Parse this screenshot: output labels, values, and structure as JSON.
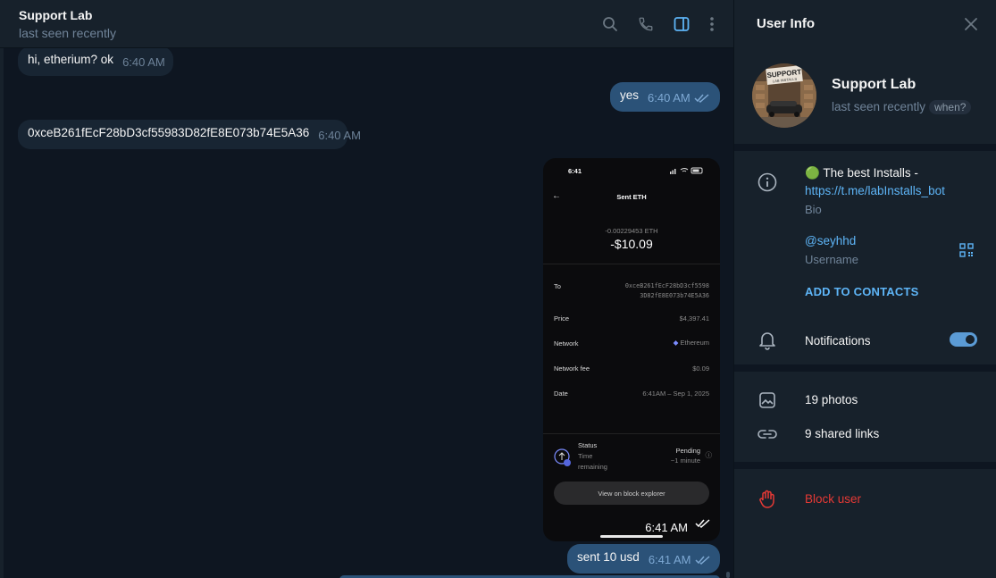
{
  "chat": {
    "title": "Support Lab",
    "subtitle": "last seen recently",
    "icons": [
      "search-icon",
      "phone-icon",
      "sidebar-toggle-icon",
      "more-vert-icon"
    ],
    "messages": [
      {
        "dir": "in",
        "text": "hi, etherium? ok",
        "time": "6:40 AM"
      },
      {
        "dir": "out",
        "text": "yes",
        "time": "6:40 AM"
      },
      {
        "dir": "in",
        "text": "0xceB261fEcF28bD3cf55983D82fE8E073b74E5A36",
        "time": "6:40 AM"
      },
      {
        "dir": "out",
        "text": "sent 10 usd",
        "time": "6:41 AM"
      }
    ],
    "photo": {
      "time": "6:41 AM",
      "phone_clock": "6:41",
      "header": "Sent ETH",
      "eth_amount": "-0.00229453 ETH",
      "usd_amount": "-$10.09",
      "to_label": "To",
      "to_line1": "0xceB261fEcF28bD3cf5598",
      "to_line2": "3D82fE8E073b74E5A36",
      "price_label": "Price",
      "price_value": "$4,397.41",
      "network_label": "Network",
      "network_value": "Ethereum",
      "fee_label": "Network fee",
      "fee_value": "$0.09",
      "date_label": "Date",
      "date_value": "6:41AM – Sep 1, 2025",
      "status_label": "Status",
      "status_sub1": "Time",
      "status_sub2": "remaining",
      "pending": "Pending",
      "pending_eta": "~1 minute",
      "explorer_button": "View on block explorer"
    }
  },
  "panel": {
    "title": "User Info",
    "name": "Support Lab",
    "status": "last seen recently",
    "when": "when?",
    "avatar_text": "SUPPORT LAB INSTALLS",
    "bio_emoji": "🟢",
    "bio_text": "The best Installs -",
    "bio_link": "https://t.me/labInstalls_bot",
    "bio_label": "Bio",
    "username": "@seyhhd",
    "username_label": "Username",
    "add_contacts": "ADD TO CONTACTS",
    "notifications": "Notifications",
    "notifications_on": true,
    "photos": "19 photos",
    "links": "9 shared links",
    "block": "Block user"
  },
  "colors": {
    "bg": "#0e1621",
    "panel": "#17212b",
    "incoming": "#182533",
    "outgoing": "#2b5278",
    "accent": "#5eb5f7",
    "danger": "#e53935"
  }
}
